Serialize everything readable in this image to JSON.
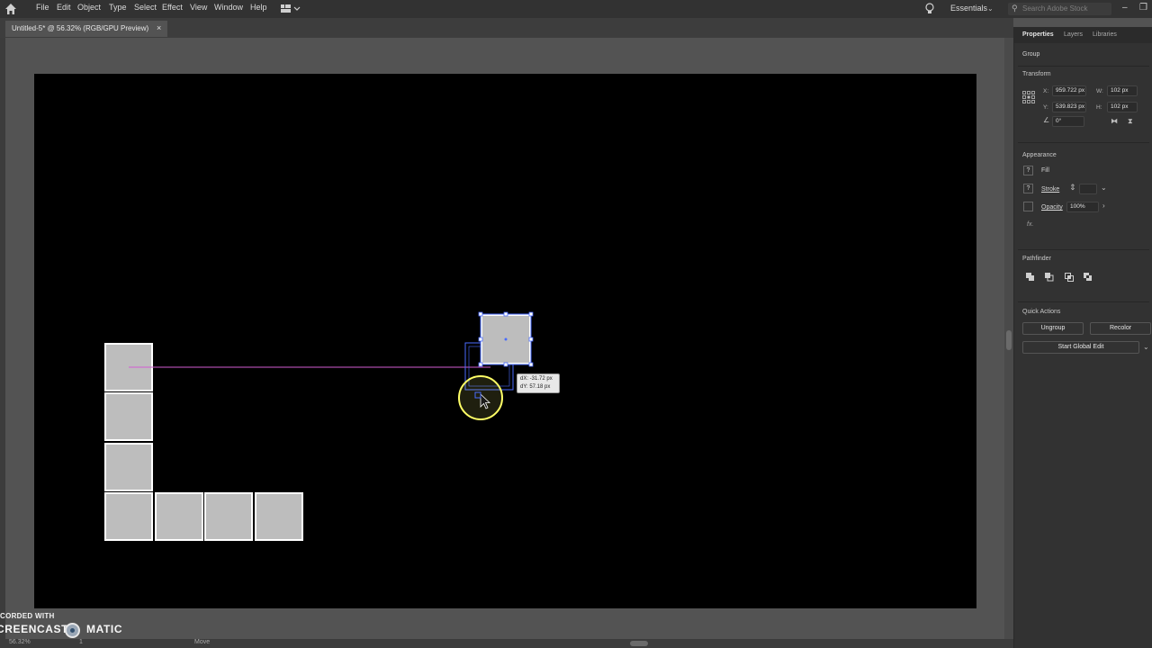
{
  "menu": {
    "items": [
      "File",
      "Edit",
      "Object",
      "Type",
      "Select",
      "Effect",
      "View",
      "Window",
      "Help"
    ],
    "workspace": "Essentials",
    "search_placeholder": "Search Adobe Stock",
    "window_buttons": [
      "–",
      "❐"
    ]
  },
  "document_tab": {
    "title": "Untitled-5* @ 56.32% (RGB/GPU Preview)",
    "close": "×"
  },
  "canvas": {
    "tooltip_dx": "dX: -31.72 px",
    "tooltip_dy": "dY: 57.18 px"
  },
  "status_bar": {
    "zoom": "56.32%",
    "page": "1",
    "selection": "Move"
  },
  "watermark": {
    "line1": "CORDED WITH",
    "word1": "CREENCAST",
    "word2": "MATIC"
  },
  "panel": {
    "tabs": [
      "Properties",
      "Layers",
      "Libraries"
    ],
    "object_type": "Group",
    "transform": {
      "title": "Transform",
      "x_label": "X:",
      "x": "959.722 px",
      "y_label": "Y:",
      "y": "539.823 px",
      "w_label": "W:",
      "w": "102 px",
      "h_label": "H:",
      "h": "102 px",
      "angle": "0°"
    },
    "appearance": {
      "title": "Appearance",
      "fill": "Fill",
      "stroke": "Stroke",
      "opacity": "Opacity",
      "opacity_value": "100%",
      "fx": "fx."
    },
    "pathfinder": {
      "title": "Pathfinder"
    },
    "quick_actions": {
      "title": "Quick Actions",
      "ungroup": "Ungroup",
      "recolor": "Recolor",
      "global_edit": "Start Global Edit"
    }
  },
  "colors": {
    "artboard": "#000000",
    "square_fill": "#bdbdbd",
    "selection": "#4a6cff",
    "guide": "#d25cd2",
    "cursor_highlight": "#ffff66"
  }
}
